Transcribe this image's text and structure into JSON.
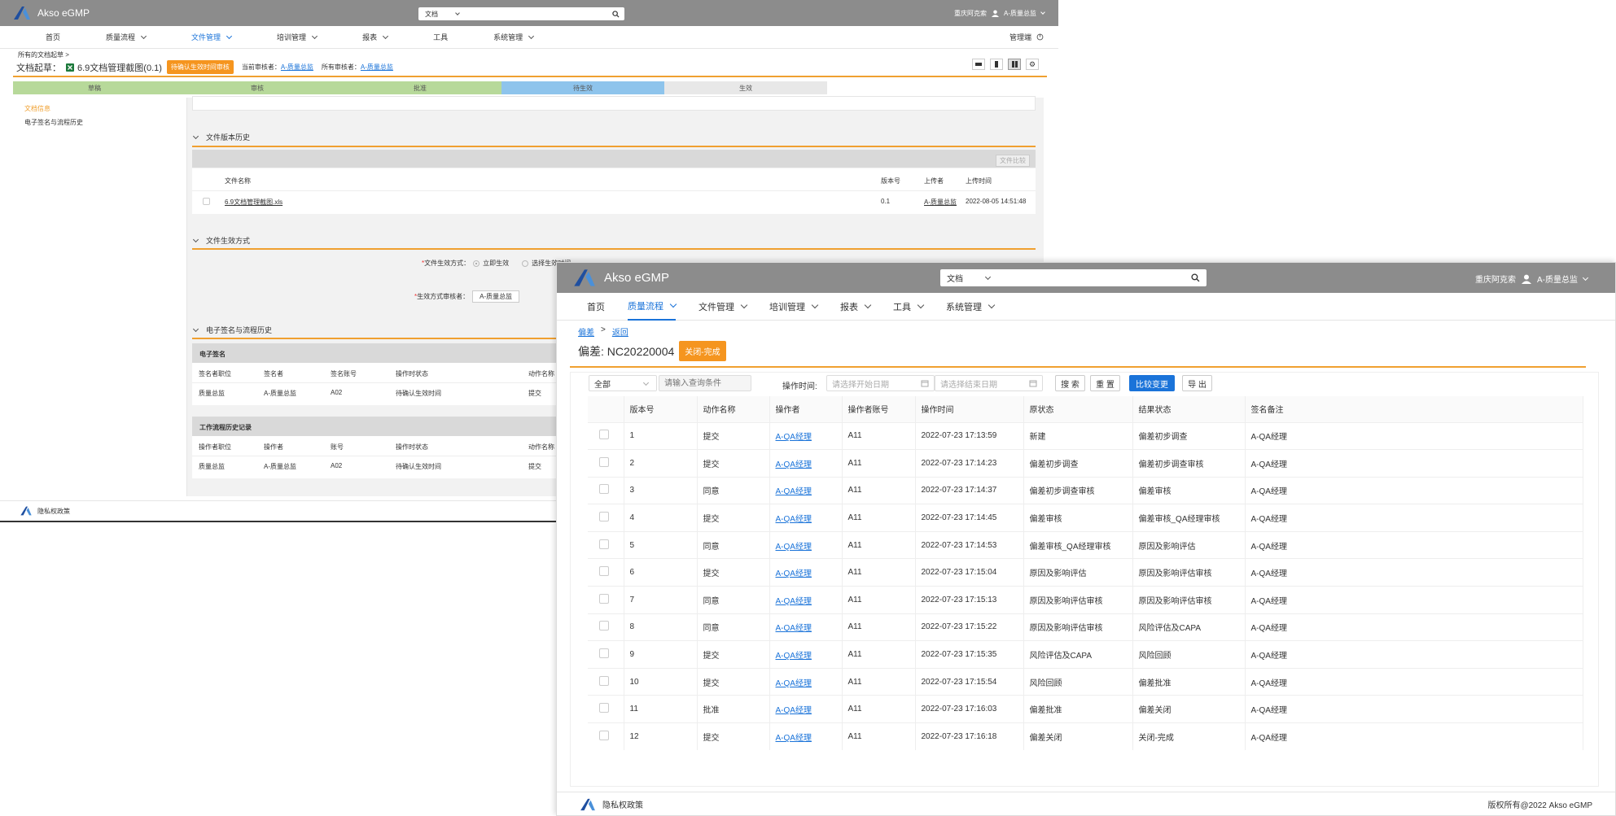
{
  "app": {
    "name": "Akso eGMP"
  },
  "header": {
    "search_scope": "文档",
    "org": "重庆阿克索",
    "user": "A-质量总监"
  },
  "nav": [
    "首页",
    "质量流程",
    "文件管理",
    "培训管理",
    "报表",
    "工具",
    "系统管理"
  ],
  "nav_right": "管理端",
  "w1": {
    "breadcrumb": "所有的文档起草 >",
    "title_prefix": "文档起草：",
    "doc_title": "6.9文档管理截图(0.1)",
    "status_badge": "待确认生效时间审核",
    "current_reviewer_label": "当前审核者：",
    "current_reviewer": "A-质量总监",
    "all_reviewer_label": "所有审核者：",
    "all_reviewer": "A-质量总监",
    "steps": [
      "草稿",
      "审核",
      "批准",
      "待生效",
      "生效"
    ],
    "sidebar": [
      "文档信息",
      "电子签名与流程历史"
    ],
    "version_section": {
      "title": "文件版本历史",
      "compare_button": "文件比较",
      "columns": [
        "文件名称",
        "版本号",
        "上传者",
        "上传时间"
      ],
      "rows": [
        {
          "name": "6.9文档管理截图.xls",
          "version": "0.1",
          "uploader": "A-质量总监",
          "time": "2022-08-05 14:51:48"
        }
      ]
    },
    "effective_section": {
      "title": "文件生效方式",
      "method_label": "文件生效方式：",
      "opt1": "立即生效",
      "opt2": "选择生效时间",
      "reviewer_label": "生效方式审核者：",
      "reviewer_value": "A-质量总监"
    },
    "esign_section": {
      "title": "电子签名与流程历史",
      "esign_title": "电子签名",
      "esign_columns": [
        "签名者职位",
        "签名者",
        "签名账号",
        "操作时状态",
        "动作名称"
      ],
      "esign_row": [
        "质量总监",
        "A-质量总监",
        "A02",
        "待确认生效时间",
        "提交"
      ],
      "wf_title": "工作流程历史记录",
      "wf_columns": [
        "操作者职位",
        "操作者",
        "账号",
        "操作时状态",
        "动作名称"
      ],
      "wf_row": [
        "质量总监",
        "A-质量总监",
        "A02",
        "待确认生效时间",
        "提交"
      ]
    },
    "footer": "隐私权政策"
  },
  "w2": {
    "breadcrumb": [
      "偏差",
      ">",
      "返回"
    ],
    "title": "偏差: NC20220004",
    "status_badge": "关闭-完成",
    "filter_select": "全部",
    "query_placeholder": "请输入查询条件",
    "time_label": "操作时间:",
    "start_placeholder": "请选择开始日期",
    "end_placeholder": "请选择结束日期",
    "buttons": {
      "search": "搜 索",
      "reset": "重 置",
      "compare": "比较变更",
      "export": "导 出"
    },
    "columns": [
      "版本号",
      "动作名称",
      "操作者",
      "操作者账号",
      "操作时间",
      "原状态",
      "结果状态",
      "签名备注"
    ],
    "rows": [
      [
        "1",
        "提交",
        "A-QA经理",
        "A11",
        "2022-07-23 17:13:59",
        "新建",
        "偏差初步调查",
        "A-QA经理"
      ],
      [
        "2",
        "提交",
        "A-QA经理",
        "A11",
        "2022-07-23 17:14:23",
        "偏差初步调查",
        "偏差初步调查审核",
        "A-QA经理"
      ],
      [
        "3",
        "同意",
        "A-QA经理",
        "A11",
        "2022-07-23 17:14:37",
        "偏差初步调查审核",
        "偏差审核",
        "A-QA经理"
      ],
      [
        "4",
        "提交",
        "A-QA经理",
        "A11",
        "2022-07-23 17:14:45",
        "偏差审核",
        "偏差审核_QA经理审核",
        "A-QA经理"
      ],
      [
        "5",
        "同意",
        "A-QA经理",
        "A11",
        "2022-07-23 17:14:53",
        "偏差审核_QA经理审核",
        "原因及影响评估",
        "A-QA经理"
      ],
      [
        "6",
        "提交",
        "A-QA经理",
        "A11",
        "2022-07-23 17:15:04",
        "原因及影响评估",
        "原因及影响评估审核",
        "A-QA经理"
      ],
      [
        "7",
        "同意",
        "A-QA经理",
        "A11",
        "2022-07-23 17:15:13",
        "原因及影响评估审核",
        "原因及影响评估审核",
        "A-QA经理"
      ],
      [
        "8",
        "同意",
        "A-QA经理",
        "A11",
        "2022-07-23 17:15:22",
        "原因及影响评估审核",
        "风险评估及CAPA",
        "A-QA经理"
      ],
      [
        "9",
        "提交",
        "A-QA经理",
        "A11",
        "2022-07-23 17:15:35",
        "风险评估及CAPA",
        "风险回顾",
        "A-QA经理"
      ],
      [
        "10",
        "提交",
        "A-QA经理",
        "A11",
        "2022-07-23 17:15:54",
        "风险回顾",
        "偏差批准",
        "A-QA经理"
      ],
      [
        "11",
        "批准",
        "A-QA经理",
        "A11",
        "2022-07-23 17:16:03",
        "偏差批准",
        "偏差关闭",
        "A-QA经理"
      ],
      [
        "12",
        "提交",
        "A-QA经理",
        "A11",
        "2022-07-23 17:16:18",
        "偏差关闭",
        "关闭-完成",
        "A-QA经理"
      ]
    ],
    "footer": "隐私权政策",
    "copyright": "版权所有@2022 Akso eGMP"
  },
  "colors": {
    "topbar": "#8c8c8c",
    "accent_orange": "#f0a030",
    "link_blue": "#1a73d9",
    "step_done": "#b7d99a",
    "step_current": "#8ec4ec"
  }
}
